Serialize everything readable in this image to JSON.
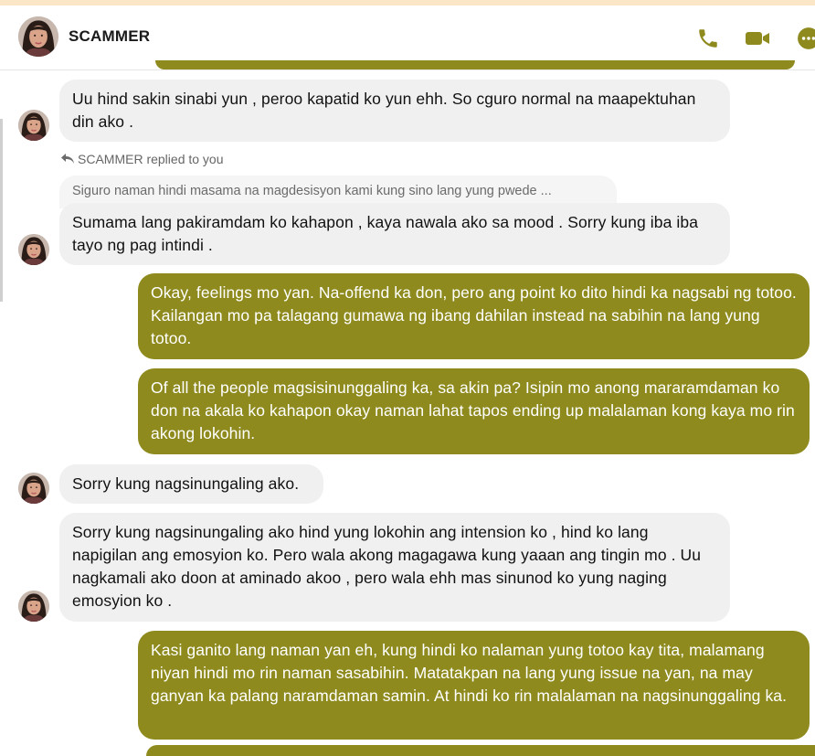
{
  "contact": {
    "name": "SCAMMER"
  },
  "header_icons": [
    "phone-icon",
    "video-icon",
    "more-icon"
  ],
  "colors": {
    "accent": "#8e8a1e",
    "incoming_bubble": "#f0f0f0",
    "outgoing_bubble": "#8e8a1e"
  },
  "reply": {
    "label": "SCAMMER replied to you",
    "quoted_text": "Siguro naman hindi masama na magdesisyon kami kung sino lang yung pwede ..."
  },
  "messages": [
    {
      "from": "SCAMMER",
      "text": "Uu hind sakin sinabi yun , peroo kapatid ko yun ehh. So cguro normal na maapektuhan din ako ."
    },
    {
      "from": "SCAMMER",
      "text": "Sumama lang pakiramdam ko kahapon , kaya nawala ako sa mood . Sorry kung iba iba tayo ng pag intindi ."
    },
    {
      "from": "me",
      "text": "Okay, feelings mo yan. Na-offend ka don, pero ang point ko dito hindi ka nagsabi ng totoo. Kailangan mo pa talagang gumawa ng ibang dahilan instead na sabihin na lang yung totoo."
    },
    {
      "from": "me",
      "text": "Of all the people magsisinunggaling ka, sa akin pa? Isipin mo anong mararamdaman ko don na akala ko kahapon okay naman lahat tapos ending up malalaman kong kaya mo rin akong lokohin."
    },
    {
      "from": "SCAMMER",
      "text": "Sorry kung nagsinungaling ako."
    },
    {
      "from": "SCAMMER",
      "text": "Sorry kung nagsinungaling ako hind yung lokohin ang intension ko , hind ko lang napigilan ang emosyion ko. Pero wala akong magagawa kung yaaan ang tingin mo . Uu nagkamali ako doon at aminado akoo , pero wala ehh mas sinunod ko yung naging emosyion ko ."
    },
    {
      "from": "me",
      "text": "Kasi ganito lang naman yan eh, kung hindi ko nalaman yung totoo kay tita, malamang niyan hindi mo rin naman sasabihin. Matatakpan na lang yung issue na yan, na may ganyan ka palang naramdaman samin. At hindi ko rin malalaman na nagsinunggaling ka."
    }
  ]
}
